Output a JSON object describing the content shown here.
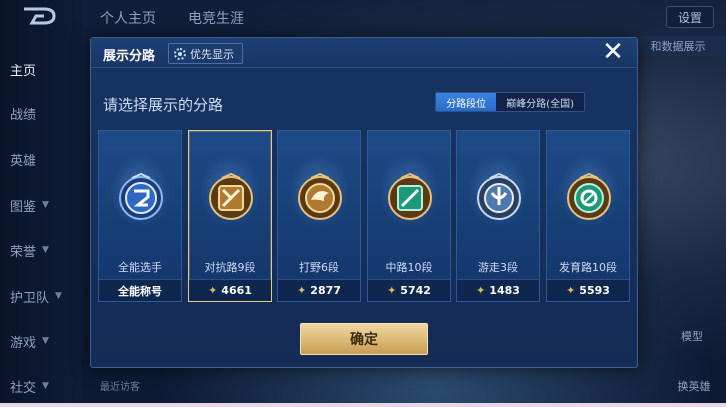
{
  "background": {
    "top_tabs": [
      "个人主页",
      "电竞生涯"
    ],
    "nav": [
      {
        "label": "主页",
        "active": true,
        "chevron": false
      },
      {
        "label": "战绩",
        "active": false,
        "chevron": false
      },
      {
        "label": "英雄",
        "active": false,
        "chevron": false
      },
      {
        "label": "图鉴",
        "active": false,
        "chevron": true
      },
      {
        "label": "荣誉",
        "active": false,
        "chevron": true
      },
      {
        "label": "护卫队",
        "active": false,
        "chevron": true
      },
      {
        "label": "游戏",
        "active": false,
        "chevron": true
      },
      {
        "label": "社交",
        "active": false,
        "chevron": true
      }
    ],
    "settings_label": "设置",
    "side_chip": "和数据展示",
    "right_labels": [
      "模型",
      "换英雄"
    ],
    "recent_label": "最近访客"
  },
  "modal": {
    "title": "展示分路",
    "priority_label": "优先显示",
    "close_icon": "close-icon",
    "subtitle": "请选择展示的分路",
    "segment": {
      "options": [
        "分路段位",
        "巅峰分路(全国)"
      ],
      "active_index": 0
    },
    "cards": [
      {
        "label": "全能选手",
        "footer": "全能称号",
        "has_points": false,
        "selected": false,
        "badge": "all-round-badge-icon",
        "color": "#3f86e6"
      },
      {
        "label": "对抗路9段",
        "footer": "4661",
        "has_points": true,
        "selected": true,
        "badge": "clash-lane-badge-icon",
        "color": "#c38a39"
      },
      {
        "label": "打野6段",
        "footer": "2877",
        "has_points": true,
        "selected": false,
        "badge": "jungle-badge-icon",
        "color": "#c38a39"
      },
      {
        "label": "中路10段",
        "footer": "5742",
        "has_points": true,
        "selected": false,
        "badge": "mid-lane-badge-icon",
        "color": "#2bb089"
      },
      {
        "label": "游走3段",
        "footer": "1483",
        "has_points": true,
        "selected": false,
        "badge": "roam-badge-icon",
        "color": "#7aa5d8"
      },
      {
        "label": "发育路10段",
        "footer": "5593",
        "has_points": true,
        "selected": false,
        "badge": "farm-lane-badge-icon",
        "color": "#2bb089"
      }
    ],
    "confirm_label": "确定"
  }
}
